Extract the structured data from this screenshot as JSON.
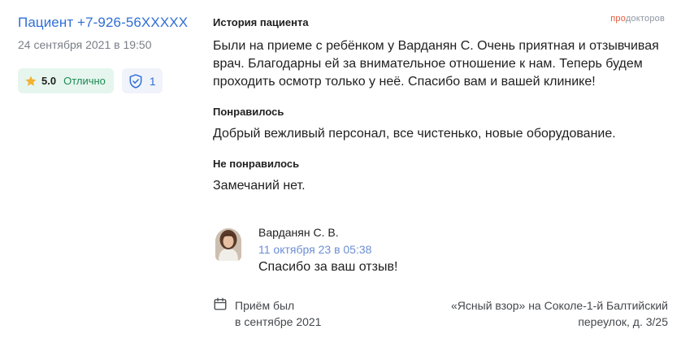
{
  "patient": {
    "name": "Пациент +7-926-56XXXXX",
    "date": "24 сентября 2021 в 19:50",
    "rating": {
      "score": "5.0",
      "label": "Отлично"
    },
    "verified_count": "1"
  },
  "logo": {
    "part1": "про",
    "part2": "докторов"
  },
  "review": {
    "story_title": "История пациента",
    "story_text": "Были на приеме с ребёнком у Варданян С. Очень приятная и отзывчивая врач. Благодарны ей за внимательное отношение к нам. Теперь будем проходить осмотр только у неё. Спасибо вам и вашей клинике!",
    "liked_title": "Понравилось",
    "liked_text": "Добрый вежливый персонал, все чистенько, новые оборудование.",
    "disliked_title": "Не понравилось",
    "disliked_text": "Замечаний нет."
  },
  "reply": {
    "author": "Варданян С. В.",
    "date": "11 октября 23 в 05:38",
    "text": "Спасибо за ваш отзыв!"
  },
  "footer": {
    "visit_line1": "Приём был",
    "visit_line2": "в сентябре 2021",
    "clinic_line1": "«Ясный взор» на Соколе-1-й Балтийский",
    "clinic_line2": "переулок, д. 3/25"
  },
  "icons": {
    "rating": "star-icon",
    "verified": "shield-check-icon",
    "visit": "calendar-icon"
  },
  "colors": {
    "link": "#2f6fd6",
    "rating_bg": "#e6f6ee",
    "rating_text": "#1c8a52",
    "star": "#f2b233",
    "logo_accent": "#e8593a"
  }
}
